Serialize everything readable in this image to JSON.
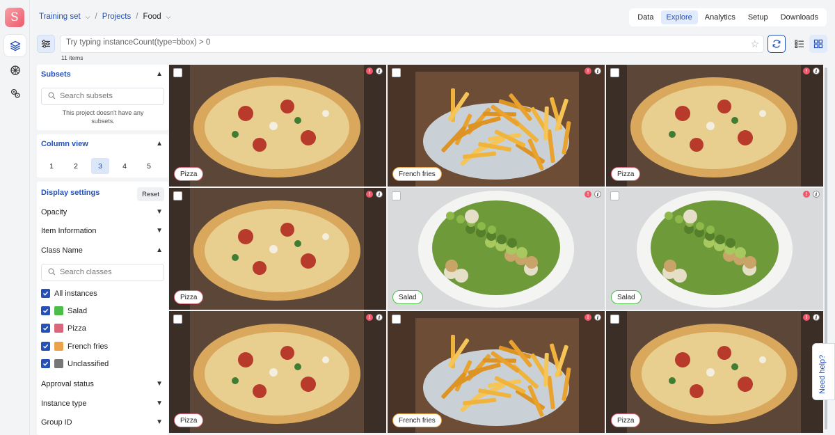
{
  "app": {
    "logo_letter": "S"
  },
  "rail": {
    "items": [
      {
        "icon": "layers-icon",
        "active": true
      },
      {
        "icon": "brain-icon",
        "active": false
      },
      {
        "icon": "settings-gears-icon",
        "active": false
      }
    ]
  },
  "breadcrumb": {
    "dataset": "Training set",
    "projects": "Projects",
    "current": "Food"
  },
  "nav": {
    "tabs": [
      "Data",
      "Explore",
      "Analytics",
      "Setup",
      "Downloads"
    ],
    "active": "Explore"
  },
  "search": {
    "placeholder": "Try typing instanceCount(type=bbox) > 0",
    "value": ""
  },
  "results": {
    "count_label": "11 items"
  },
  "sidebar": {
    "subsets": {
      "title": "Subsets",
      "search_placeholder": "Search subsets",
      "empty_note": "This project doesn't have any subsets."
    },
    "column_view": {
      "title": "Column view",
      "options": [
        "1",
        "2",
        "3",
        "4",
        "5"
      ],
      "selected": "3"
    },
    "display_settings": {
      "title": "Display settings",
      "reset_label": "Reset",
      "opacity": "Opacity",
      "item_information": "Item Information",
      "class_name": "Class Name",
      "class_search_placeholder": "Search classes",
      "all_instances": "All instances",
      "classes": [
        {
          "name": "Salad",
          "color": "#4dbd4a"
        },
        {
          "name": "Pizza",
          "color": "#d9667a"
        },
        {
          "name": "French fries",
          "color": "#eba24a"
        },
        {
          "name": "Unclassified",
          "color": "#777777"
        }
      ],
      "approval_status": "Approval status",
      "instance_type": "Instance type",
      "group_id": "Group ID"
    }
  },
  "grid": {
    "items": [
      {
        "label": "Pizza",
        "kind": "pizza",
        "chip_color": "#d9667a"
      },
      {
        "label": "French fries",
        "kind": "fries",
        "chip_color": "#eba24a"
      },
      {
        "label": "Pizza",
        "kind": "pizza",
        "chip_color": "#d9667a"
      },
      {
        "label": "Pizza",
        "kind": "pizza",
        "chip_color": "#d9667a"
      },
      {
        "label": "Salad",
        "kind": "salad",
        "chip_color": "#4dbd4a"
      },
      {
        "label": "Salad",
        "kind": "salad",
        "chip_color": "#4dbd4a"
      },
      {
        "label": "Pizza",
        "kind": "pizza",
        "chip_color": "#d9667a"
      },
      {
        "label": "French fries",
        "kind": "fries",
        "chip_color": "#eba24a"
      },
      {
        "label": "Pizza",
        "kind": "pizza",
        "chip_color": "#d9667a"
      }
    ]
  },
  "help": {
    "label": "Need help?"
  }
}
